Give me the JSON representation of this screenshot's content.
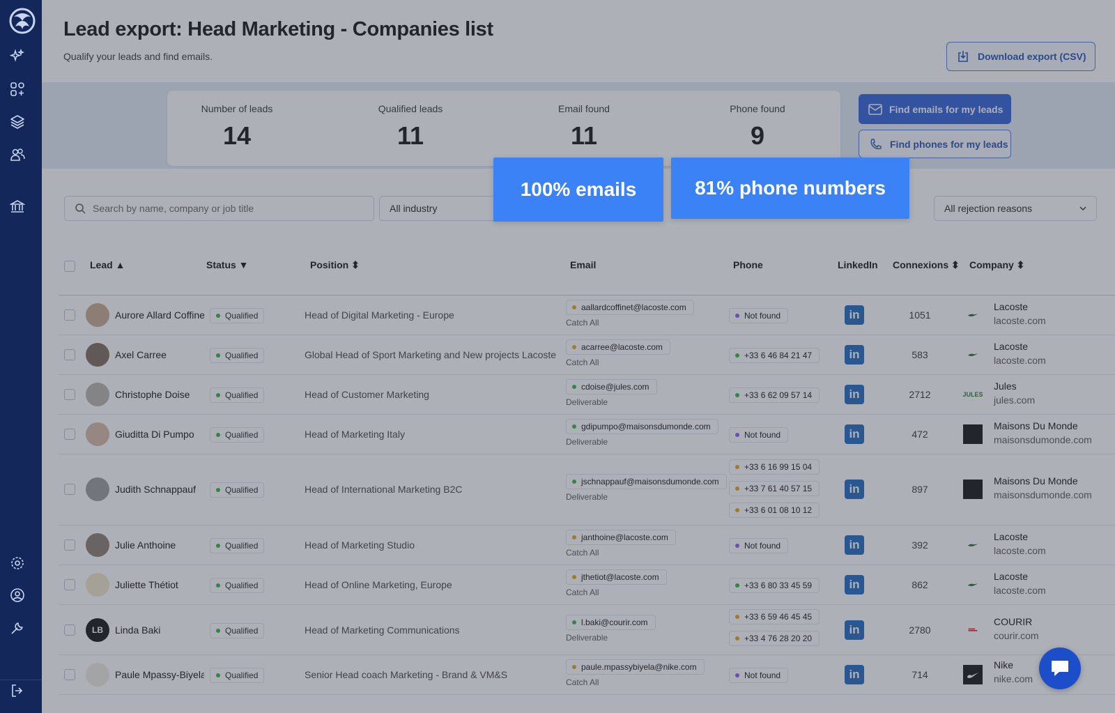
{
  "page": {
    "title": "Lead export: Head Marketing - Companies list",
    "subtitle": "Qualify your leads and find emails.",
    "download_label": "Download export (CSV)"
  },
  "stats": [
    {
      "label": "Number of leads",
      "value": "14"
    },
    {
      "label": "Qualified leads",
      "value": "11"
    },
    {
      "label": "Email found",
      "value": "11"
    },
    {
      "label": "Phone found",
      "value": "9"
    }
  ],
  "actions": {
    "find_emails": "Find emails for my leads",
    "find_phones": "Find phones for my leads"
  },
  "highlights": {
    "emails": "100% emails",
    "phones": "81% phone numbers"
  },
  "filters": {
    "search_placeholder": "Search by name, company or job title",
    "industry": "All industry",
    "rejection": "All rejection reasons"
  },
  "columns": {
    "lead": "Lead ▲",
    "status": "Status ▼",
    "position": "Position ⬍",
    "email": "Email",
    "phone": "Phone",
    "linkedin": "LinkedIn",
    "connexions": "Connexions ⬍",
    "company": "Company ⬍"
  },
  "rows": [
    {
      "name": "Aurore Allard Coffinet",
      "status": "Qualified",
      "position": "Head of Digital Marketing - Europe",
      "email": "aallardcoffinet@lacoste.com",
      "email_status": "Catch All",
      "phones": [
        "Not found"
      ],
      "connexions": "1051",
      "company": "Lacoste",
      "domain": "lacoste.com"
    },
    {
      "name": "Axel Carree",
      "status": "Qualified",
      "position": "Global Head of Sport Marketing and New projects Lacoste",
      "email": "acarree@lacoste.com",
      "email_status": "Catch All",
      "phones": [
        "+33 6 46 84 21 47"
      ],
      "connexions": "583",
      "company": "Lacoste",
      "domain": "lacoste.com"
    },
    {
      "name": "Christophe Doise",
      "status": "Qualified",
      "position": "Head of Customer Marketing",
      "email": "cdoise@jules.com",
      "email_status": "Deliverable",
      "phones": [
        "+33 6 62 09 57 14"
      ],
      "connexions": "2712",
      "company": "Jules",
      "domain": "jules.com",
      "logo_text": "JULES"
    },
    {
      "name": "Giuditta Di Pumpo",
      "status": "Qualified",
      "position": "Head of Marketing Italy",
      "email": "gdipumpo@maisonsdumonde.com",
      "email_status": "Deliverable",
      "phones": [
        "Not found"
      ],
      "connexions": "472",
      "company": "Maisons Du Monde",
      "domain": "maisonsdumonde.com"
    },
    {
      "name": "Judith Schnappauf",
      "status": "Qualified",
      "position": "Head of International Marketing B2C",
      "email": "jschnappauf@maisonsdumonde.com",
      "email_status": "Deliverable",
      "phones": [
        "+33 6 16 99 15 04",
        "+33 7 61 40 57 15",
        "+33 6 01 08 10 12"
      ],
      "connexions": "897",
      "company": "Maisons Du Monde",
      "domain": "maisonsdumonde.com"
    },
    {
      "name": "Julie Anthoine",
      "status": "Qualified",
      "position": "Head of Marketing Studio",
      "email": "janthoine@lacoste.com",
      "email_status": "Catch All",
      "phones": [
        "Not found"
      ],
      "connexions": "392",
      "company": "Lacoste",
      "domain": "lacoste.com"
    },
    {
      "name": "Juliette Thétiot",
      "status": "Qualified",
      "position": "Head of Online Marketing, Europe",
      "email": "jthetiot@lacoste.com",
      "email_status": "Catch All",
      "phones": [
        "+33 6 80 33 45 59"
      ],
      "connexions": "862",
      "company": "Lacoste",
      "domain": "lacoste.com"
    },
    {
      "name": "Linda Baki",
      "avatar_initials": "LB",
      "status": "Qualified",
      "position": "Head of Marketing Communications",
      "email": "l.baki@courir.com",
      "email_status": "Deliverable",
      "phones": [
        "+33 6 59 46 45 45",
        "+33 4 76 28 20 20"
      ],
      "connexions": "2780",
      "company": "COURIR",
      "domain": "courir.com"
    },
    {
      "name": "Paule Mpassy-Biyela",
      "status": "Qualified",
      "position": "Senior Head coach Marketing - Brand & VM&S",
      "email": "paule.mpassybiyela@nike.com",
      "email_status": "Catch All",
      "phones": [
        "Not found"
      ],
      "connexions": "714",
      "company": "Nike",
      "domain": "nike.com"
    }
  ],
  "linkedin_label": "in",
  "colors": {
    "sidebar": "#13275a",
    "primary": "#2d5ed8",
    "highlight": "#3b82f6",
    "linkedin": "#1a66c2",
    "qualified_dot": "#2fb344",
    "catch_all_dot": "#e8a317",
    "not_found_dot": "#8b5cf6"
  }
}
